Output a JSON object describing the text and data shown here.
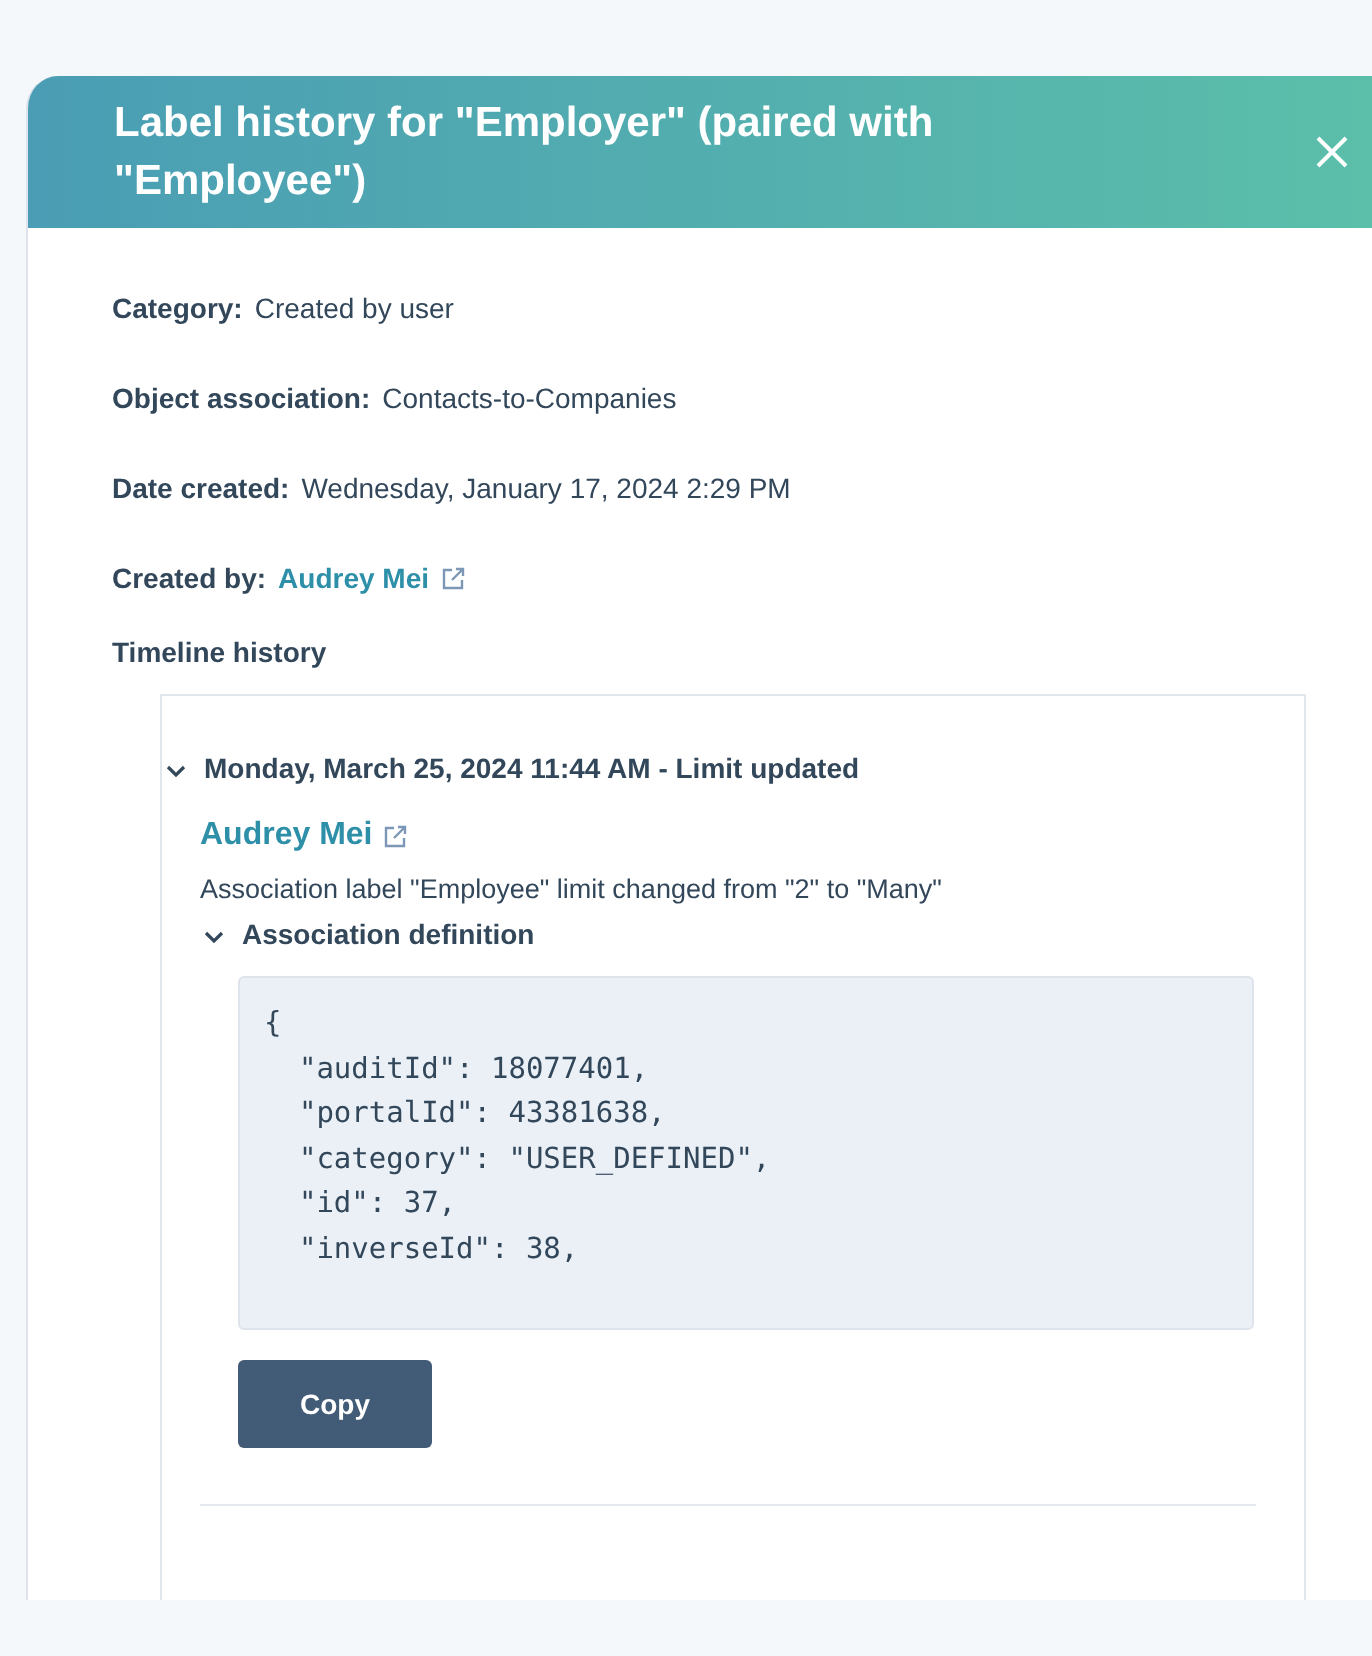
{
  "dialog": {
    "title": "Label history for \"Employer\" (paired with \"Employee\")"
  },
  "details": [
    {
      "label": "Category:",
      "value": "Created by user",
      "kind": "text"
    },
    {
      "label": "Object association:",
      "value": "Contacts-to-Companies",
      "kind": "text"
    },
    {
      "label": "Date created:",
      "value": "Wednesday, January 17, 2024 2:29 PM",
      "kind": "text"
    },
    {
      "label": "Created by:",
      "value": "Audrey Mei",
      "kind": "link"
    }
  ],
  "timeline": {
    "heading": "Timeline history",
    "entries": [
      {
        "title": "Monday, March 25, 2024 11:44 AM - Limit updated",
        "expanded": true,
        "author": "Audrey Mei",
        "description": "Association label \"Employee\" limit changed from \"2\" to \"Many\"",
        "definition": {
          "title": "Association definition",
          "expanded": true,
          "code_lines": [
            "{",
            "  \"auditId\": 18077401,",
            "  \"portalId\": 43381638,",
            "  \"category\": \"USER_DEFINED\",",
            "  \"id\": 37,",
            "  \"inverseId\": 38,"
          ],
          "copy_button": "Copy"
        }
      }
    ]
  }
}
